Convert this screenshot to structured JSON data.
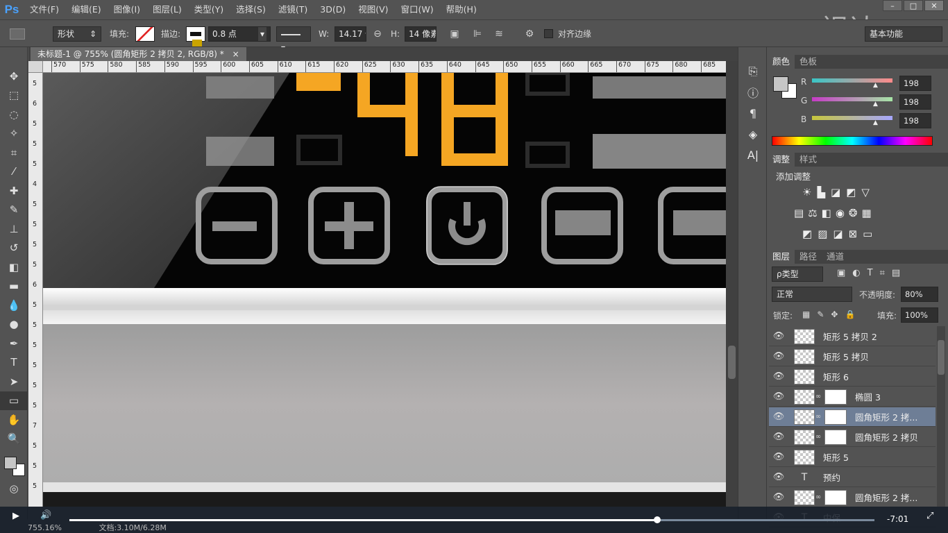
{
  "app": {
    "logo": "Ps"
  },
  "menu": [
    "文件(F)",
    "编辑(E)",
    "图像(I)",
    "图层(L)",
    "类型(Y)",
    "选择(S)",
    "滤镜(T)",
    "3D(D)",
    "视图(V)",
    "窗口(W)",
    "帮助(H)"
  ],
  "watermark": "视达",
  "workspace": "基本功能",
  "options": {
    "mode": "形状",
    "fill_label": "填充:",
    "stroke_label": "描边:",
    "stroke_width": "0.8 点",
    "w_label": "W:",
    "w_value": "14.17 像",
    "h_label": "H:",
    "h_value": "14 像素",
    "align_edges": "对齐边缘"
  },
  "document": {
    "tab_title": "未标题-1 @ 755% (圆角矩形 2 拷贝 2, RGB/8) *",
    "close": "×"
  },
  "ruler_h": [
    "570",
    "575",
    "580",
    "585",
    "590",
    "595",
    "600",
    "605",
    "610",
    "615",
    "620",
    "625",
    "630",
    "635",
    "640",
    "645",
    "650",
    "655",
    "660",
    "665",
    "670",
    "675",
    "680",
    "685"
  ],
  "ruler_v": [
    "5",
    "6",
    "5",
    "5",
    "5",
    "4",
    "5",
    "5",
    "5",
    "5",
    "6",
    "5",
    "5",
    "5",
    "5",
    "5",
    "5",
    "7",
    "5",
    "5",
    "5"
  ],
  "color_panel": {
    "tabs": [
      "颜色",
      "色板"
    ],
    "channels": [
      {
        "label": "R",
        "value": "198"
      },
      {
        "label": "G",
        "value": "198"
      },
      {
        "label": "B",
        "value": "198"
      }
    ]
  },
  "adjust_panel": {
    "tabs": [
      "调整",
      "样式"
    ],
    "heading": "添加调整"
  },
  "layers_panel": {
    "tabs": [
      "图层",
      "路径",
      "通道"
    ],
    "filter": "ρ类型",
    "blend_mode": "正常",
    "opacity_label": "不透明度:",
    "opacity": "80%",
    "lock_label": "锁定:",
    "fill_label": "填充:",
    "fill": "100%",
    "layers": [
      {
        "name": "矩形 5 拷贝 2",
        "type": "shape",
        "mask": false,
        "selected": false
      },
      {
        "name": "矩形 5 拷贝",
        "type": "shape",
        "mask": false,
        "selected": false
      },
      {
        "name": "矩形 6",
        "type": "shape",
        "mask": false,
        "selected": false
      },
      {
        "name": "椭圆 3",
        "type": "shape",
        "mask": true,
        "selected": false
      },
      {
        "name": "圆角矩形 2 拷...",
        "type": "shape",
        "mask": true,
        "selected": true
      },
      {
        "name": "圆角矩形 2 拷贝",
        "type": "shape",
        "mask": true,
        "selected": false
      },
      {
        "name": "矩形 5",
        "type": "shape",
        "mask": false,
        "selected": false
      },
      {
        "name": "预约",
        "type": "text",
        "mask": false,
        "selected": false
      },
      {
        "name": "圆角矩形 2 拷...",
        "type": "shape",
        "mask": true,
        "selected": false
      },
      {
        "name": "中保",
        "type": "text",
        "mask": false,
        "selected": false
      }
    ]
  },
  "status": {
    "zoom": "755.16%",
    "doc": "文档:3.10M/6.28M"
  },
  "player": {
    "time": "-7:01",
    "progress": 0.73
  },
  "colors": {
    "accent_digit": "#f5a623",
    "selection": "#6e7e96",
    "canvas_bg": "#0a0a0a"
  }
}
